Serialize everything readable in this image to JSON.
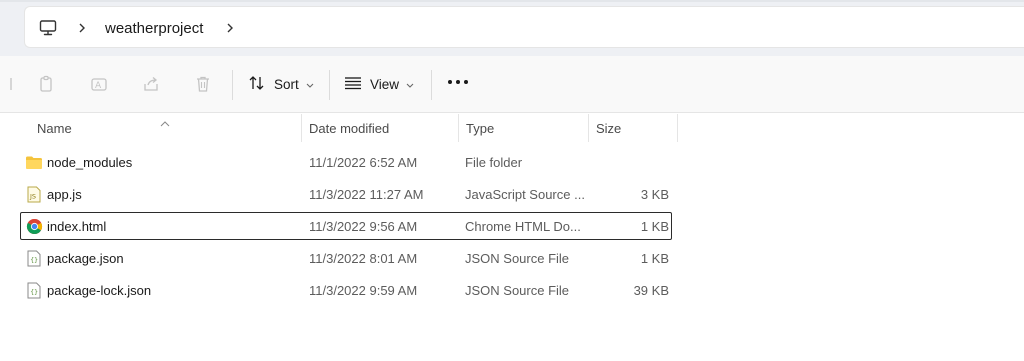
{
  "address_bar": {
    "root_icon": "computer-icon",
    "crumb": "weatherproject"
  },
  "toolbar": {
    "icons": [
      "copy-icon",
      "rename-icon",
      "share-icon",
      "delete-icon"
    ],
    "sort_label": "Sort",
    "view_label": "View",
    "more_icon": "more-icon"
  },
  "columns": {
    "name": "Name",
    "date": "Date modified",
    "type": "Type",
    "size": "Size"
  },
  "files": [
    {
      "icon": "folder-icon",
      "name": "node_modules",
      "date": "11/1/2022 6:52 AM",
      "type": "File folder",
      "size": ""
    },
    {
      "icon": "js-file-icon",
      "name": "app.js",
      "date": "11/3/2022 11:27 AM",
      "type": "JavaScript Source ...",
      "size": "3 KB"
    },
    {
      "icon": "chrome-icon",
      "name": "index.html",
      "date": "11/3/2022 9:56 AM",
      "type": "Chrome HTML Do...",
      "size": "1 KB",
      "selected": true
    },
    {
      "icon": "json-file-icon",
      "name": "package.json",
      "date": "11/3/2022 8:01 AM",
      "type": "JSON Source File",
      "size": "1 KB"
    },
    {
      "icon": "json-file-icon",
      "name": "package-lock.json",
      "date": "11/3/2022 9:59 AM",
      "type": "JSON Source File",
      "size": "39 KB"
    }
  ],
  "colors": {
    "folder": "#f4c33c",
    "selection_border": "#2b2b2b",
    "muted_text": "#5c5c5c"
  }
}
